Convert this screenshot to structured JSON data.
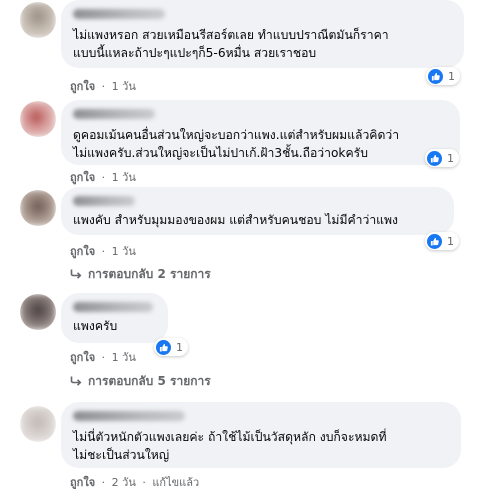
{
  "comments": [
    {
      "text_lines": [
        "ไม่แพงหรอก สวยเหมือนรีสอร์ตเลย ทำแบบปราณีตมันก็ราคา",
        "แบบนี้แหละถ้าปะๆแปะๆก็5-6หมื่น สวยเราชอบ"
      ],
      "like_label": "ถูกใจ",
      "time": "1 วัน",
      "reactions": "1"
    },
    {
      "text_lines": [
        "ดูคอมเม้นคนอื่นส่วนใหญ่จะบอกว่าแพง.แต่สำหรับผมแล้วคิดว่า",
        "ไม่แพงครับ.ส่วนใหญ่จะเป็นไม่ปาเก้.ฝ้า3ชั้น.ถือว่าokครับ"
      ],
      "like_label": "ถูกใจ",
      "time": "1 วัน",
      "reactions": "1"
    },
    {
      "text_lines": [
        "แพงคับ สำหรับมุมมองของผม แต่สำหรับคนชอบ ไม่มีคำว่าแพง"
      ],
      "like_label": "ถูกใจ",
      "time": "1 วัน",
      "reactions": "1",
      "replies_label": "การตอบกลับ 2 รายการ"
    },
    {
      "text_lines": [
        "แพงครับ"
      ],
      "like_label": "ถูกใจ",
      "time": "1 วัน",
      "reactions": "1",
      "replies_label": "การตอบกลับ 5 รายการ"
    },
    {
      "text_lines": [
        "ไม่นี่ตัวหนักตัวแพงเลยค่ะ ถ้าใช้ไม้เป็นวัสดุหลัก งบก็จะหมดที่",
        "ไม่ชะเป็นส่วนใหญ่"
      ],
      "like_label": "ถูกใจ",
      "time": "2 วัน",
      "edited": "แก้ไขแล้ว"
    }
  ],
  "separator": "·",
  "colors": {
    "bubble": "#f0f2f5",
    "meta": "#65676b",
    "like_blue": "#1877f2"
  }
}
